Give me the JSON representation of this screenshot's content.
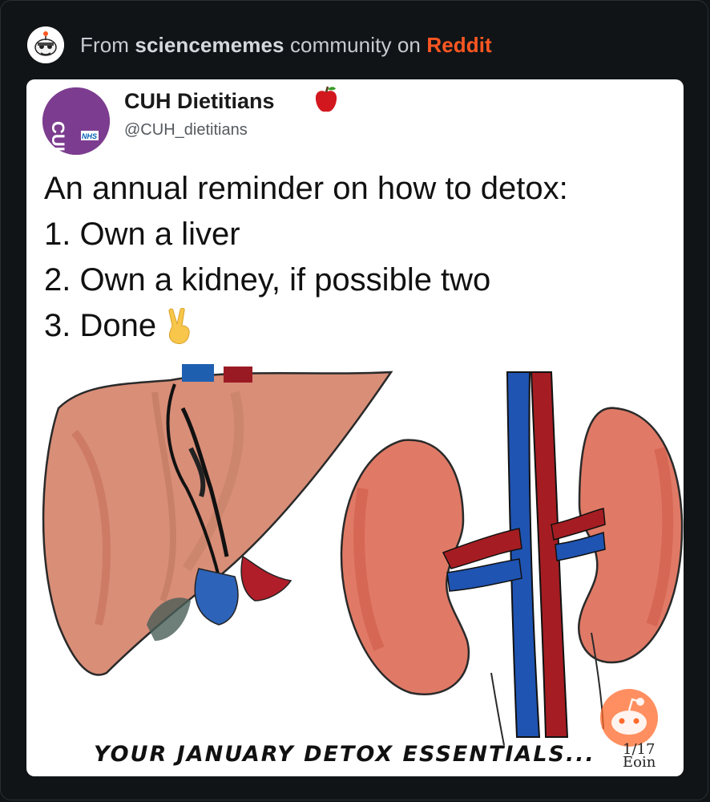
{
  "header": {
    "prefix": "From ",
    "community": "sciencememes",
    "middle": " community on ",
    "platform": "Reddit"
  },
  "tweet": {
    "display_name": "CUH Dietitians",
    "handle": "@CUH_dietitians",
    "avatar_text": "CUH",
    "avatar_badge": "NHS",
    "lines": [
      "An annual reminder on how to detox:",
      "1. Own a liver",
      "2. Own a kidney, if possible two",
      "3. Done"
    ]
  },
  "illustration": {
    "caption": "YOUR JANUARY DETOX ESSENTIALS...",
    "signature_line1": "1/17",
    "signature_line2": "Eoin"
  },
  "colors": {
    "background": "#101417",
    "reddit_orange": "#ff5722",
    "profile_purple": "#7c3c8f"
  },
  "icons": [
    "snoo-avatar-icon",
    "apple-icon",
    "victory-hand-icon",
    "reddit-watermark-icon"
  ]
}
